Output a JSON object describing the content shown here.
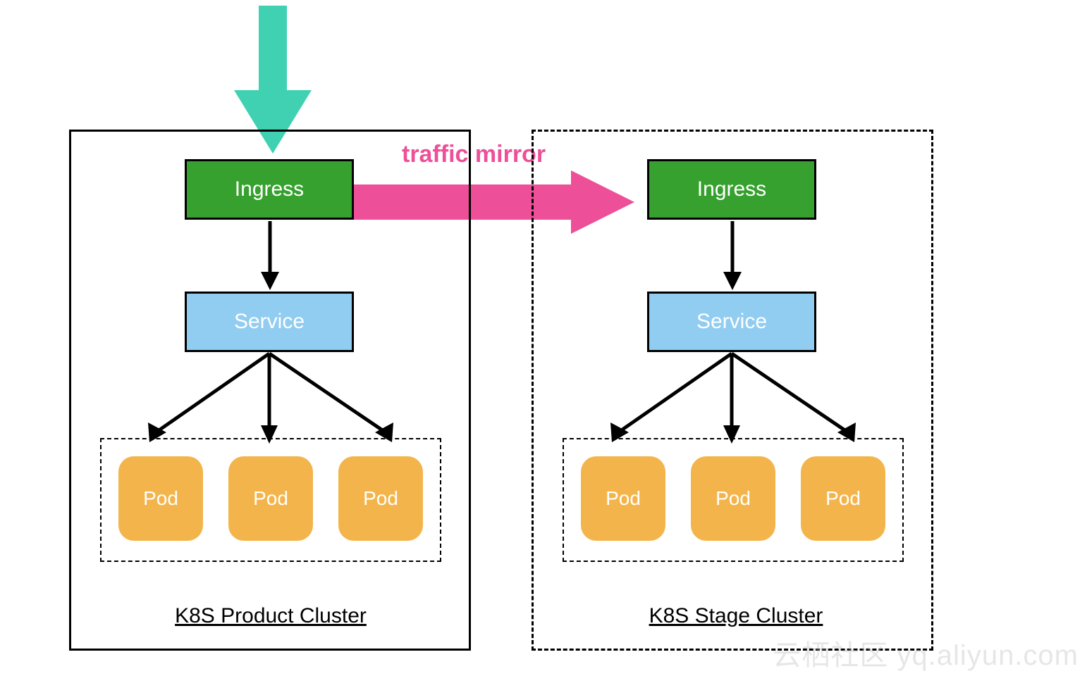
{
  "colors": {
    "ingress": "#36a12e",
    "service": "#91ccf1",
    "pod": "#f3b54b",
    "entry_arrow": "#3fd1b2",
    "mirror_arrow": "#ed4f99",
    "flow_arrow": "#000000"
  },
  "mirror_label": "traffic mirror",
  "watermark": "云栖社区 yq.aliyun.com",
  "clusters": {
    "product": {
      "caption": "K8S Product Cluster",
      "border": "solid",
      "ingress_label": "Ingress",
      "service_label": "Service",
      "pods": [
        {
          "label": "Pod"
        },
        {
          "label": "Pod"
        },
        {
          "label": "Pod"
        }
      ]
    },
    "stage": {
      "caption": "K8S Stage Cluster",
      "border": "dashed",
      "ingress_label": "Ingress",
      "service_label": "Service",
      "pods": [
        {
          "label": "Pod"
        },
        {
          "label": "Pod"
        },
        {
          "label": "Pod"
        }
      ]
    }
  },
  "flows": [
    {
      "from": "external",
      "to": "product.ingress",
      "kind": "entry"
    },
    {
      "from": "product.ingress",
      "to": "stage.ingress",
      "kind": "mirror",
      "label": "traffic mirror"
    },
    {
      "from": "product.ingress",
      "to": "product.service",
      "kind": "internal"
    },
    {
      "from": "product.service",
      "to": "product.pods",
      "kind": "fanout"
    },
    {
      "from": "stage.ingress",
      "to": "stage.service",
      "kind": "internal"
    },
    {
      "from": "stage.service",
      "to": "stage.pods",
      "kind": "fanout"
    }
  ]
}
